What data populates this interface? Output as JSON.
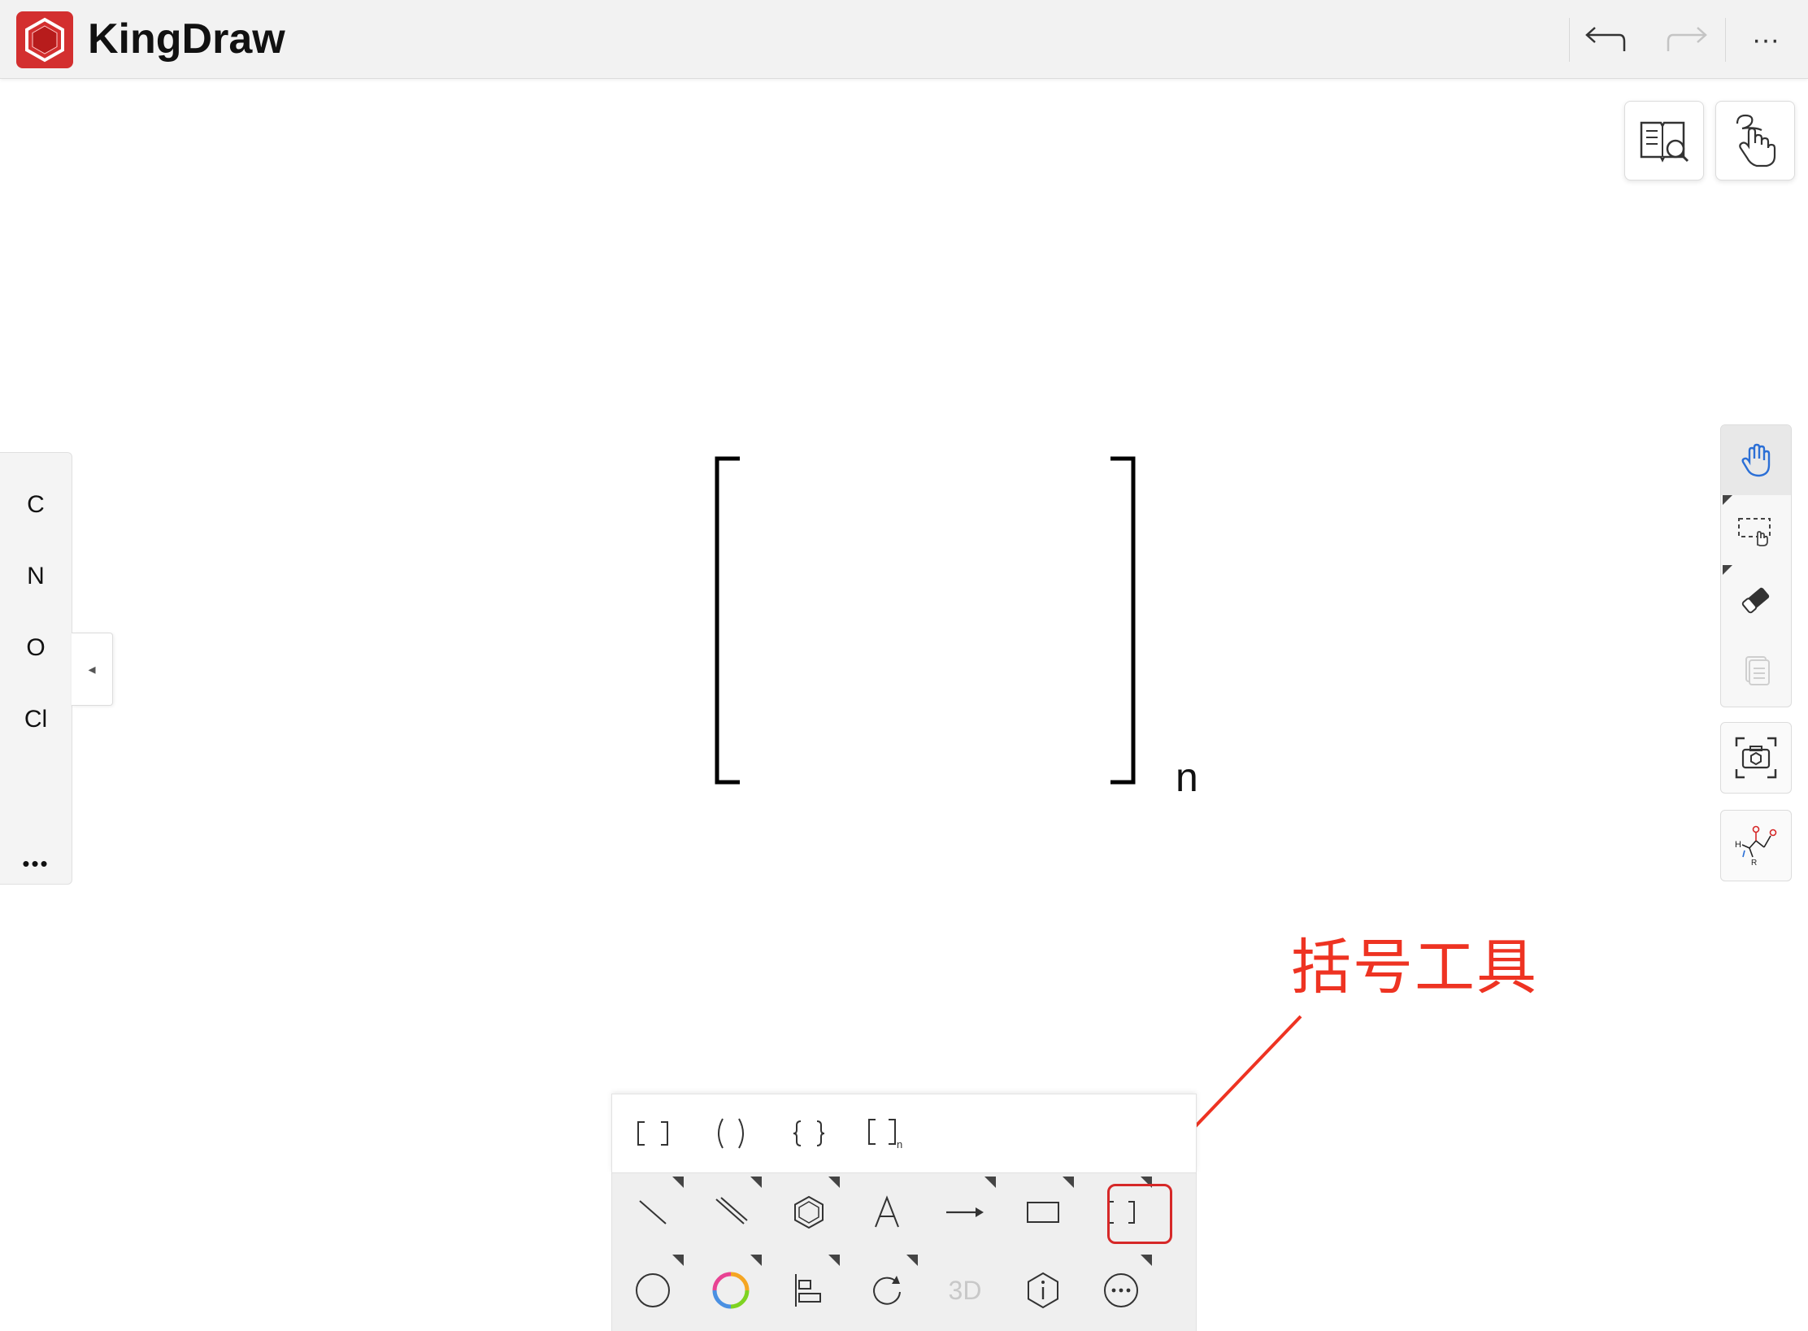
{
  "app": {
    "title": "KingDraw",
    "brand_color": "#d32f2f"
  },
  "header": {
    "undo_icon": "undo-arrow-icon",
    "redo_icon": "redo-arrow-icon",
    "more_label": "···"
  },
  "top_right_buttons": [
    {
      "icon": "book-search-icon"
    },
    {
      "icon": "hand-draw-gesture-icon"
    }
  ],
  "element_panel": {
    "elements": [
      "C",
      "N",
      "O",
      "Cl"
    ],
    "more_label": "•••",
    "collapse_label": "◂"
  },
  "right_toolbar": [
    {
      "icon": "hand-pan-icon",
      "active": true,
      "accent": "#2b6fd6"
    },
    {
      "icon": "lasso-select-icon"
    },
    {
      "icon": "eraser-icon"
    },
    {
      "icon": "copy-pages-icon",
      "disabled": true
    },
    {
      "icon": "camera-scan-icon"
    },
    {
      "icon": "reaction-template-icon"
    }
  ],
  "canvas": {
    "bracket_subscript": "n"
  },
  "bracket_menu": {
    "items": [
      {
        "label": "[ ]",
        "icon": "square-bracket-icon"
      },
      {
        "label": "( )",
        "icon": "parenthesis-icon"
      },
      {
        "label": "{ }",
        "icon": "curly-brace-icon"
      },
      {
        "label": "[ ]n",
        "icon": "bracket-with-n-icon"
      }
    ]
  },
  "bottom_toolbar": {
    "row1": [
      {
        "icon": "single-bond-icon"
      },
      {
        "icon": "double-bond-icon"
      },
      {
        "icon": "benzene-ring-icon"
      },
      {
        "icon": "text-icon",
        "label": "A"
      },
      {
        "icon": "arrow-icon"
      },
      {
        "icon": "rectangle-icon"
      },
      {
        "icon": "bracket-tool-icon",
        "label": "[ ]",
        "highlighted": true
      }
    ],
    "row2": [
      {
        "icon": "circle-icon"
      },
      {
        "icon": "color-wheel-icon"
      },
      {
        "icon": "align-left-icon"
      },
      {
        "icon": "rotate-icon"
      },
      {
        "icon": "3d-icon",
        "label": "3D",
        "disabled": true
      },
      {
        "icon": "info-hexagon-icon"
      },
      {
        "icon": "more-circle-icon"
      }
    ]
  },
  "annotation": {
    "label": "括号工具",
    "color": "#ee3322"
  }
}
